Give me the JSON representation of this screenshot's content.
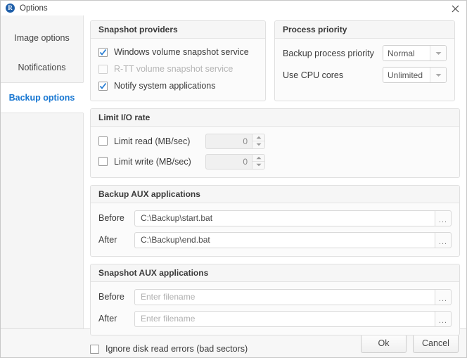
{
  "window": {
    "title": "Options",
    "app_icon": "app-logo-icon",
    "close_icon": "close-icon"
  },
  "sidebar": {
    "items": [
      {
        "label": "Image options",
        "selected": false
      },
      {
        "label": "Notifications",
        "selected": false
      },
      {
        "label": "Backup options",
        "selected": true
      }
    ]
  },
  "snapshot_providers": {
    "title": "Snapshot providers",
    "options": [
      {
        "label": "Windows volume snapshot service",
        "checked": true,
        "disabled": false
      },
      {
        "label": "R-TT volume snapshot service",
        "checked": false,
        "disabled": true
      },
      {
        "label": "Notify system applications",
        "checked": true,
        "disabled": false
      }
    ]
  },
  "process_priority": {
    "title": "Process priority",
    "fields": [
      {
        "label": "Backup process priority",
        "value": "Normal"
      },
      {
        "label": "Use CPU cores",
        "value": "Unlimited"
      }
    ]
  },
  "limit_io": {
    "title": "Limit I/O rate",
    "rows": [
      {
        "label": "Limit read (MB/sec)",
        "checked": false,
        "value": "0"
      },
      {
        "label": "Limit write (MB/sec)",
        "checked": false,
        "value": "0"
      }
    ]
  },
  "backup_aux": {
    "title": "Backup AUX applications",
    "rows": [
      {
        "label": "Before",
        "value": "C:\\Backup\\start.bat",
        "placeholder": "Enter filename",
        "is_placeholder": false
      },
      {
        "label": "After",
        "value": "C:\\Backup\\end.bat",
        "placeholder": "Enter filename",
        "is_placeholder": false
      }
    ],
    "browse_label": "..."
  },
  "snapshot_aux": {
    "title": "Snapshot AUX applications",
    "rows": [
      {
        "label": "Before",
        "value": "Enter filename",
        "placeholder": "Enter filename",
        "is_placeholder": true
      },
      {
        "label": "After",
        "value": "Enter filename",
        "placeholder": "Enter filename",
        "is_placeholder": true
      }
    ],
    "browse_label": "..."
  },
  "ignore_errors": {
    "label": "Ignore disk read errors (bad sectors)",
    "checked": false
  },
  "footer": {
    "ok_label": "Ok",
    "cancel_label": "Cancel"
  },
  "colors": {
    "accent": "#1877d2",
    "checkmark": "#2a7fd4",
    "panel_border": "#e0e0e0",
    "sidebar_bg": "#f5f5f5"
  }
}
